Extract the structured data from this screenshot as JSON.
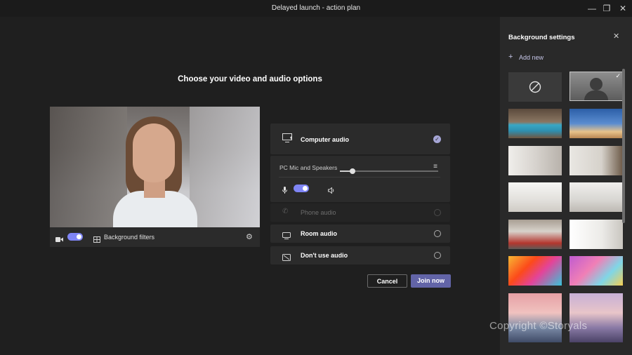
{
  "window": {
    "title": "Delayed launch - action plan"
  },
  "main": {
    "heading": "Choose your video and audio options",
    "video_bar": {
      "background_filters_label": "Background filters",
      "camera_on": true
    },
    "audio": {
      "computer_audio_label": "Computer audio",
      "device_label": "PC Mic and Speakers",
      "mic_on": true,
      "speaker_volume": 0.13,
      "phone_audio_label": "Phone audio",
      "room_audio_label": "Room audio",
      "dont_use_audio_label": "Don't use audio"
    },
    "cancel_label": "Cancel",
    "join_label": "Join now"
  },
  "sidebar": {
    "title": "Background settings",
    "add_new_label": "Add new",
    "selected_index": 1
  },
  "watermark": "Copyright ©Storyals",
  "colors": {
    "accent": "#6264a7",
    "toggle": "#7f85f5",
    "background": "#1f1f1f",
    "panel": "#292929",
    "card": "#2b2b2b"
  }
}
